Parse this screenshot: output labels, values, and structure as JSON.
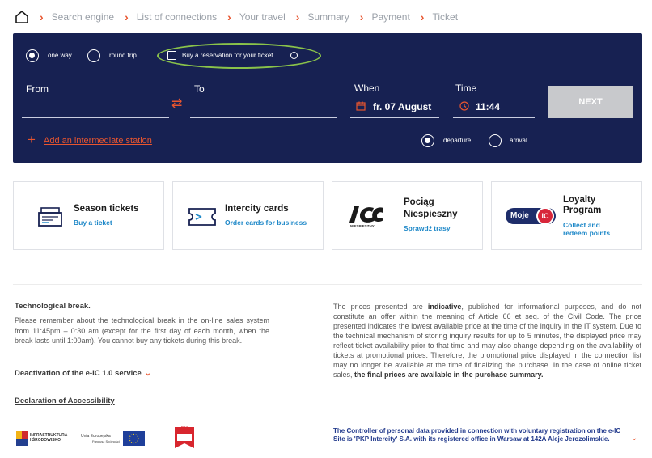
{
  "breadcrumb": {
    "home_icon": "home-icon",
    "items": [
      "Search engine",
      "List of connections",
      "Your travel",
      "Summary",
      "Payment",
      "Ticket"
    ]
  },
  "search": {
    "one_way": "one way",
    "round_trip": "round trip",
    "reservation_label": "Buy a reservation for your ticket",
    "from_label": "From",
    "to_label": "To",
    "when_label": "When",
    "time_label": "Time",
    "date_value": "fr. 07 August",
    "time_value": "11:44",
    "next_button": "NEXT",
    "add_station": "Add an intermediate station",
    "departure": "departure",
    "arrival": "arrival",
    "colors": {
      "panel": "#172152",
      "accent": "#e8552f",
      "highlight_ring": "#8ac34a"
    }
  },
  "cards": [
    {
      "title": "Season tickets",
      "subtitle": "Buy a ticket",
      "icon": "season-ticket-icon"
    },
    {
      "title": "Intercity cards",
      "subtitle": "Order cards for business",
      "icon": "card-icon"
    },
    {
      "title_line1": "Pociąg",
      "title_line2": "Niespieszny",
      "subtitle": "Sprawdź trasy",
      "logo_caption": "NIESPIESZNY"
    },
    {
      "title_line1": "Loyalty",
      "title_line2": "Program",
      "subtitle_line1": "Collect and",
      "subtitle_line2": "redeem points",
      "logo_left": "Moje",
      "logo_right": "IC"
    }
  ],
  "footer": {
    "tech_title": "Technological break.",
    "tech_text": "Please remember about the technological break in the on-line sales system from 11:45pm – 0:30 am (except for the first day of each month, when the break lasts until 1:00am). You cannot buy any tickets during this break.",
    "deactivation": "Deactivation of the e-IC 1.0 service",
    "accessibility": "Declaration of Accessibility",
    "prices_1": "The prices presented are",
    "prices_bold_1": "indicative",
    "prices_2": ", published for informational purposes, and do not constitute an offer within the meaning of Article 66 et seq. of the Civil Code. The price presented indicates the lowest available price at the time of the inquiry in the IT system. Due to the technical mechanism of storing inquiry results for up to 5 minutes, the displayed price may reflect ticket availability prior to that time and may also change depending on the availability of tickets at promotional prices. Therefore, the promotional price displayed in the connection list may no longer be available at the time of finalizing the purchase. In the case of online ticket sales,",
    "prices_bold_2": "the final prices are available in the purchase summary.",
    "controller": "The Controller of personal data provided in connection with voluntary registration on the e-IC Site is 'PKP Intercity' S.A. with its registered office in Warsaw at 142A Aleje Jerozolimskie.",
    "logo_infra_1": "INFRASTRUKTURA",
    "logo_infra_2": "I ŚRODOWISKO",
    "logo_eu_1": "Unia Europejska",
    "logo_eu_2": "Fundusz Spójności",
    "logo_bip": "bip"
  }
}
